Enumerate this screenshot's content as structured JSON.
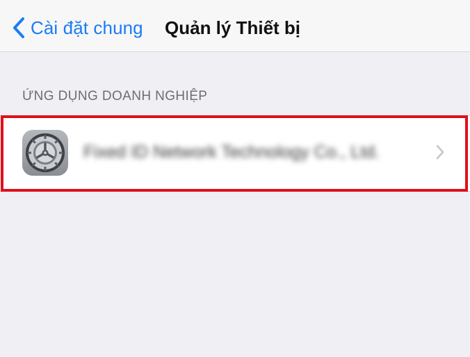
{
  "navbar": {
    "back_label": "Cài đặt chung",
    "title": "Quản lý Thiết bị",
    "back_icon": "chevron-left-icon"
  },
  "section": {
    "header": "ỨNG DỤNG DOANH NGHIỆP"
  },
  "list": {
    "items": [
      {
        "label": "Fixed ID Network Technology Co., Ltd.",
        "icon": "settings-gear-icon",
        "disclosure_icon": "chevron-right-icon"
      }
    ]
  },
  "colors": {
    "accent": "#1a7cf3",
    "highlight": "#e0101a",
    "background": "#efeff4"
  }
}
